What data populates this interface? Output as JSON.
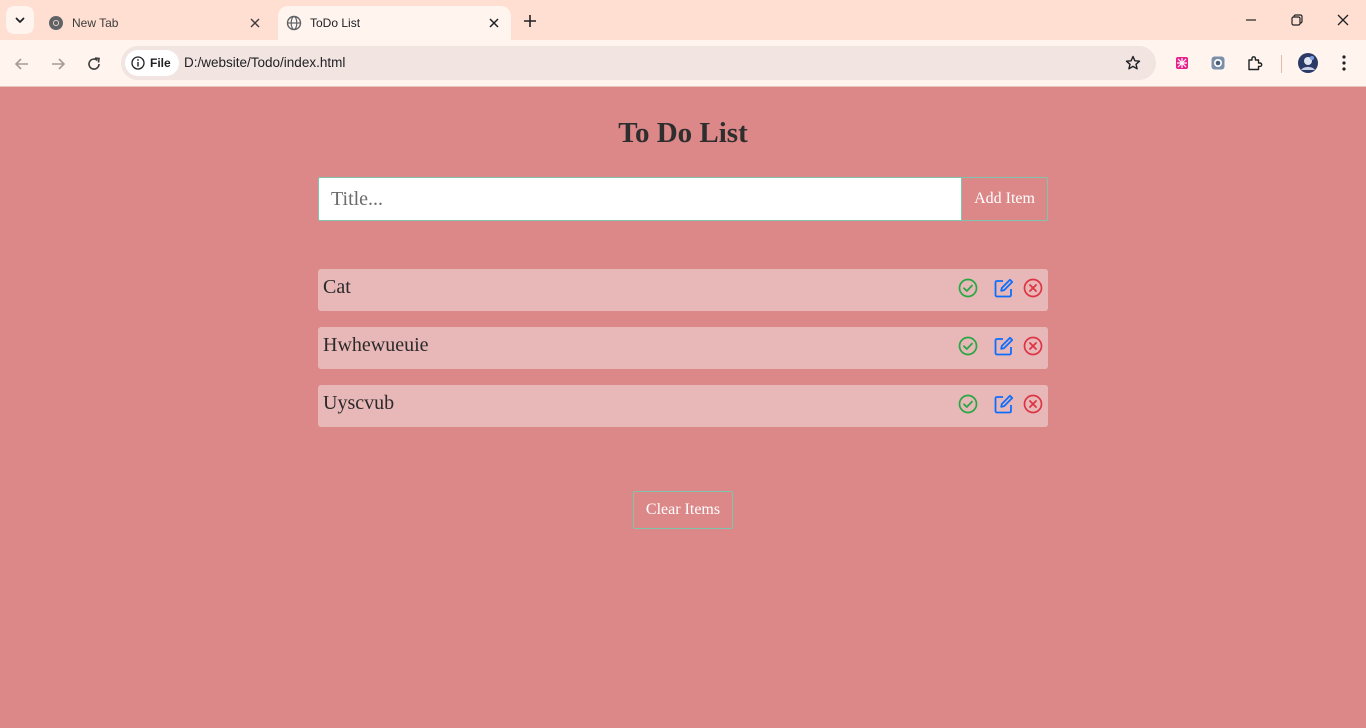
{
  "browser": {
    "tabs": [
      {
        "title": "New Tab"
      },
      {
        "title": "ToDo List"
      }
    ],
    "omnibox": {
      "scheme_label": "File",
      "url": "D:/website/Todo/index.html"
    }
  },
  "page": {
    "heading": "To Do List",
    "input": {
      "placeholder": "Title...",
      "value": ""
    },
    "add_label": "Add Item",
    "items": [
      {
        "text": "Cat"
      },
      {
        "text": "Hwhewueuie"
      },
      {
        "text": "Uyscvub"
      }
    ],
    "clear_label": "Clear Items"
  },
  "colors": {
    "page_background": "#dc8889",
    "item_background": "#e8b7b7",
    "accent_border": "#7fc4ae",
    "check": "#28a745",
    "edit": "#0d6efd",
    "remove": "#dc3545",
    "tabstrip": "#ffdfd1"
  },
  "icons": [
    "tab-search-icon",
    "chrome-icon",
    "globe-icon",
    "close-icon",
    "plus-icon",
    "minimize-icon",
    "restore-icon",
    "back-icon",
    "forward-icon",
    "reload-icon",
    "info-icon",
    "star-icon",
    "extension-icon",
    "profile-avatar",
    "check-circle-icon",
    "pencil-square-icon",
    "x-circle-icon"
  ]
}
